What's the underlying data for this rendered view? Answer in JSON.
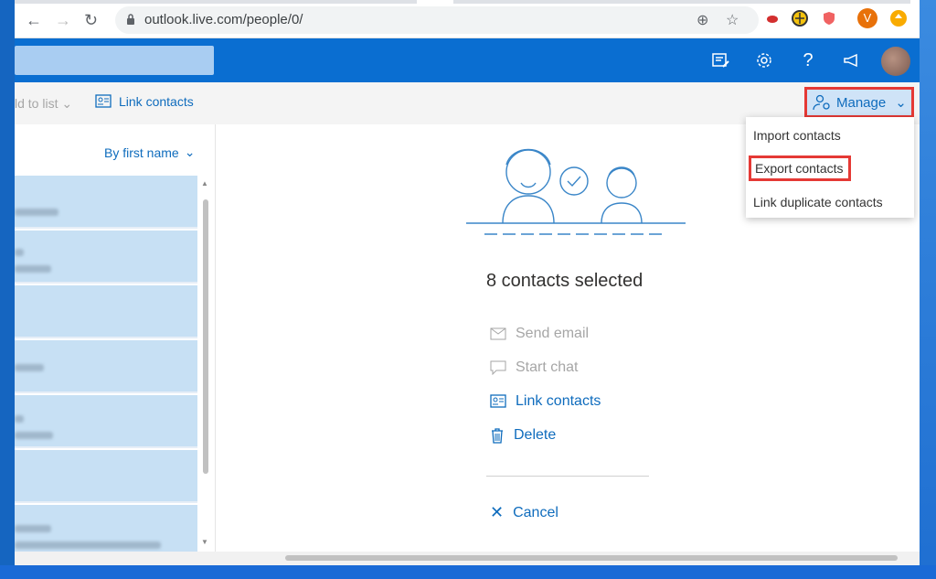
{
  "browser": {
    "url_host": "outlook.live.com",
    "url_path": "/people/0/",
    "ext_avatar_letter": "V"
  },
  "commandbar": {
    "add_to_list_label": "ld to list",
    "link_contacts_label": "Link contacts",
    "manage_label": "Manage"
  },
  "manage_menu": {
    "items": [
      "Import contacts",
      "Export contacts",
      "Link duplicate contacts"
    ]
  },
  "list": {
    "sort_label": "By first name"
  },
  "main": {
    "selected_title": "8 contacts selected",
    "actions": {
      "send_email": "Send email",
      "start_chat": "Start chat",
      "link_contacts": "Link contacts",
      "delete": "Delete",
      "cancel": "Cancel"
    }
  },
  "colors": {
    "accent": "#0f6cbd",
    "header": "#0a6ed1",
    "highlight_box": "#e53935",
    "selected_row": "#c7e0f4"
  }
}
